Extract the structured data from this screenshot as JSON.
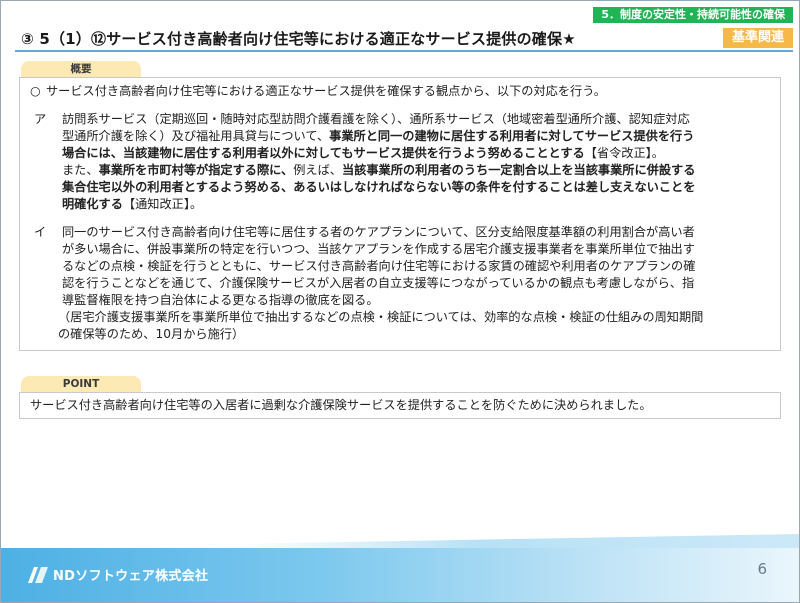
{
  "header": {
    "category": "5．制度の安定性・持続可能性の確保",
    "standard_tag": "基準関連",
    "title": "③ 5（1）⑫サービス付き高齢者向け住宅等における適正なサービス提供の確保★"
  },
  "overview": {
    "tab_label": "概要",
    "lead_mark": "○",
    "lead_text": "サービス付き高齢者向け住宅等における適正なサービス提供を確保する観点から、以下の対応を行う。",
    "items": [
      {
        "label": "ア",
        "lines": [
          [
            {
              "t": "訪問系サービス（定期巡回・随時対応型訪問介護看護を除く）、通所系サービス（地域密着型通所介護、認知症対応",
              "b": false
            }
          ],
          [
            {
              "t": "型通所介護を除く）及び福祉用具貸与について、",
              "b": false
            },
            {
              "t": "事業所と同一の建物に居住する利用者に対してサービス提供を行う",
              "b": true
            }
          ],
          [
            {
              "t": "場合には、当該建物に居住する利用者以外に対してもサービス提供を行うよう努めることとする",
              "b": true
            },
            {
              "t": "【省令改正】。",
              "b": false
            }
          ],
          [
            {
              "t": "また、",
              "b": false
            },
            {
              "t": "事業所を市町村等が指定する際に、",
              "b": true
            },
            {
              "t": "例えば、",
              "b": false
            },
            {
              "t": "当該事業所の利用者のうち一定割合以上を当該事業所に併設する",
              "b": true
            }
          ],
          [
            {
              "t": "集合住宅以外の利用者とするよう努める、あるいはしなければならない等の条件を付することは差し支えないことを",
              "b": true
            }
          ],
          [
            {
              "t": "明確化する",
              "b": true
            },
            {
              "t": "【通知改正】。",
              "b": false
            }
          ]
        ]
      },
      {
        "label": "イ",
        "lines": [
          [
            {
              "t": "同一のサービス付き高齢者向け住宅等に居住する者のケアプランについて、区分支給限度基準額の利用割合が高い者",
              "b": false
            }
          ],
          [
            {
              "t": "が多い場合に、併設事業所の特定を行いつつ、当該ケアプランを作成する居宅介護支援事業者を事業所単位で抽出す",
              "b": false
            }
          ],
          [
            {
              "t": "るなどの点検・検証を行うとともに、サービス付き高齢者向け住宅等における家賃の確認や利用者のケアプランの確",
              "b": false
            }
          ],
          [
            {
              "t": "認を行うことなどを通じて、介護保険サービスが入居者の自立支援等につながっているかの観点も考慮しながら、指",
              "b": false
            }
          ],
          [
            {
              "t": "導監督権限を持つ自治体による更なる指導の徹底を図る。",
              "b": false
            }
          ]
        ]
      }
    ],
    "note_lines": [
      "（居宅介護支援事業所を事業所単位で抽出するなどの点検・検証については、効率的な点検・検証の仕組みの周知期間",
      "の確保等のため、10月から施行）"
    ]
  },
  "point": {
    "tab_label": "POINT",
    "text": "サービス付き高齢者向け住宅等の入居者に過剰な介護保険サービスを提供することを防ぐために決められました。"
  },
  "footer": {
    "company": "NDソフトウェア株式会社",
    "page_number": "6"
  }
}
